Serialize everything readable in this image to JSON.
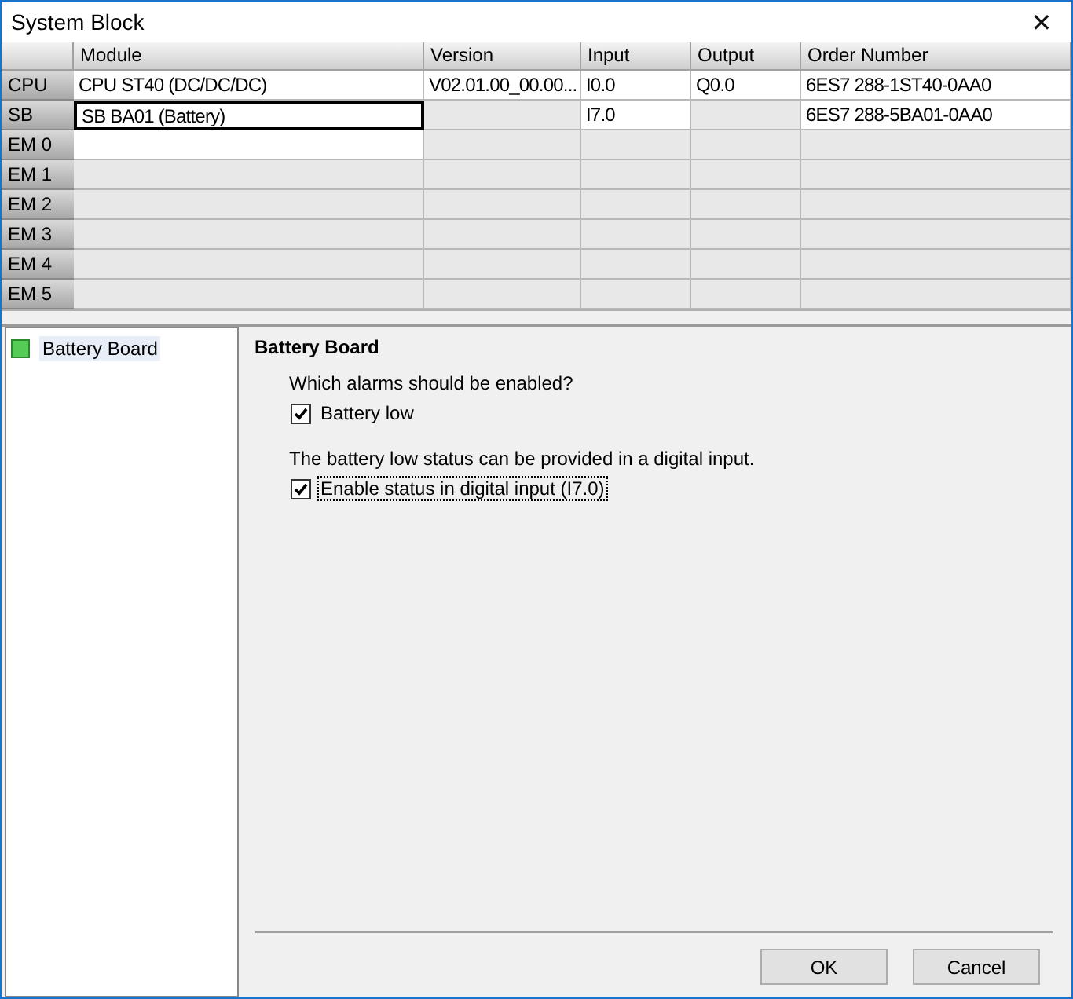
{
  "window": {
    "title": "System Block",
    "close": "✕"
  },
  "table": {
    "columns": [
      "Module",
      "Version",
      "Input",
      "Output",
      "Order Number"
    ],
    "rows": [
      {
        "label": "CPU",
        "kind": "configured",
        "selected": false,
        "cells": [
          "CPU ST40 (DC/DC/DC)",
          "V02.01.00_00.00...",
          "I0.0",
          "Q0.0",
          "6ES7 288-1ST40-0AA0"
        ]
      },
      {
        "label": "SB",
        "kind": "board",
        "selected": true,
        "cells": [
          "SB BA01 (Battery)",
          null,
          "I7.0",
          null,
          "6ES7 288-5BA01-0AA0"
        ]
      },
      {
        "label": "EM 0",
        "kind": "open",
        "selected": false,
        "cells": []
      },
      {
        "label": "EM 1",
        "kind": "empty",
        "selected": false,
        "cells": []
      },
      {
        "label": "EM 2",
        "kind": "empty",
        "selected": false,
        "cells": []
      },
      {
        "label": "EM 3",
        "kind": "empty",
        "selected": false,
        "cells": []
      },
      {
        "label": "EM 4",
        "kind": "empty",
        "selected": false,
        "cells": []
      },
      {
        "label": "EM 5",
        "kind": "empty",
        "selected": false,
        "cells": []
      }
    ]
  },
  "tree": {
    "items": [
      {
        "label": "Battery Board",
        "selected": true
      }
    ]
  },
  "panel": {
    "heading": "Battery Board",
    "groups": [
      {
        "prompt": "Which alarms should be enabled?",
        "checkbox": {
          "label": "Battery low",
          "checked": true,
          "focused": false
        }
      },
      {
        "prompt": "The battery low status can be provided in a digital input.",
        "checkbox": {
          "label": "Enable status in digital input (I7.0)",
          "checked": true,
          "focused": true
        }
      }
    ]
  },
  "buttons": [
    "OK",
    "Cancel"
  ]
}
